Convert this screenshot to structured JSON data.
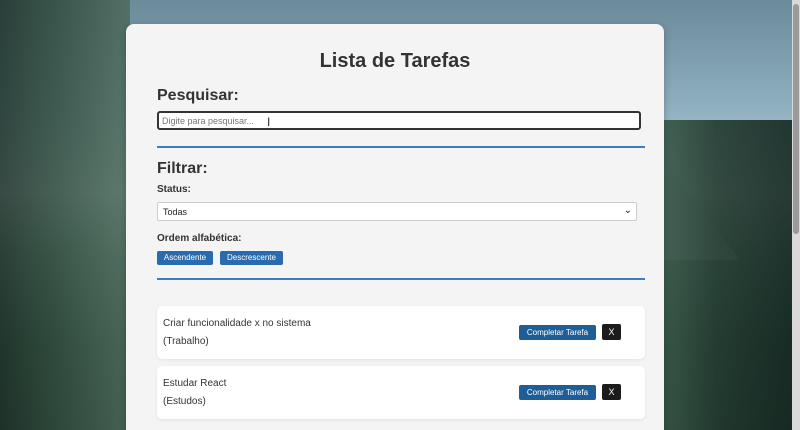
{
  "app": {
    "title": "Lista de Tarefas"
  },
  "search": {
    "heading": "Pesquisar:",
    "placeholder": "Digite para pesquisar...",
    "value": ""
  },
  "filter": {
    "heading": "Filtrar:",
    "status_label": "Status:",
    "status_selected": "Todas",
    "order_label": "Ordem alfabética:",
    "asc_label": "Ascendente",
    "desc_label": "Descrescente"
  },
  "tasks": [
    {
      "text": "Criar funcionalidade x no sistema",
      "category": "(Trabalho)",
      "complete_label": "Completar Tarefa",
      "remove_label": "X"
    },
    {
      "text": "Estudar React",
      "category": "(Estudos)",
      "complete_label": "Completar Tarefa",
      "remove_label": "X"
    }
  ],
  "colors": {
    "accent": "#2a6bb0",
    "divider": "#3a7ec0",
    "remove": "#1c1c1c"
  },
  "icons": {
    "select_chevron": "chevron-down-icon",
    "mouse_cursor": "text-cursor-icon"
  }
}
